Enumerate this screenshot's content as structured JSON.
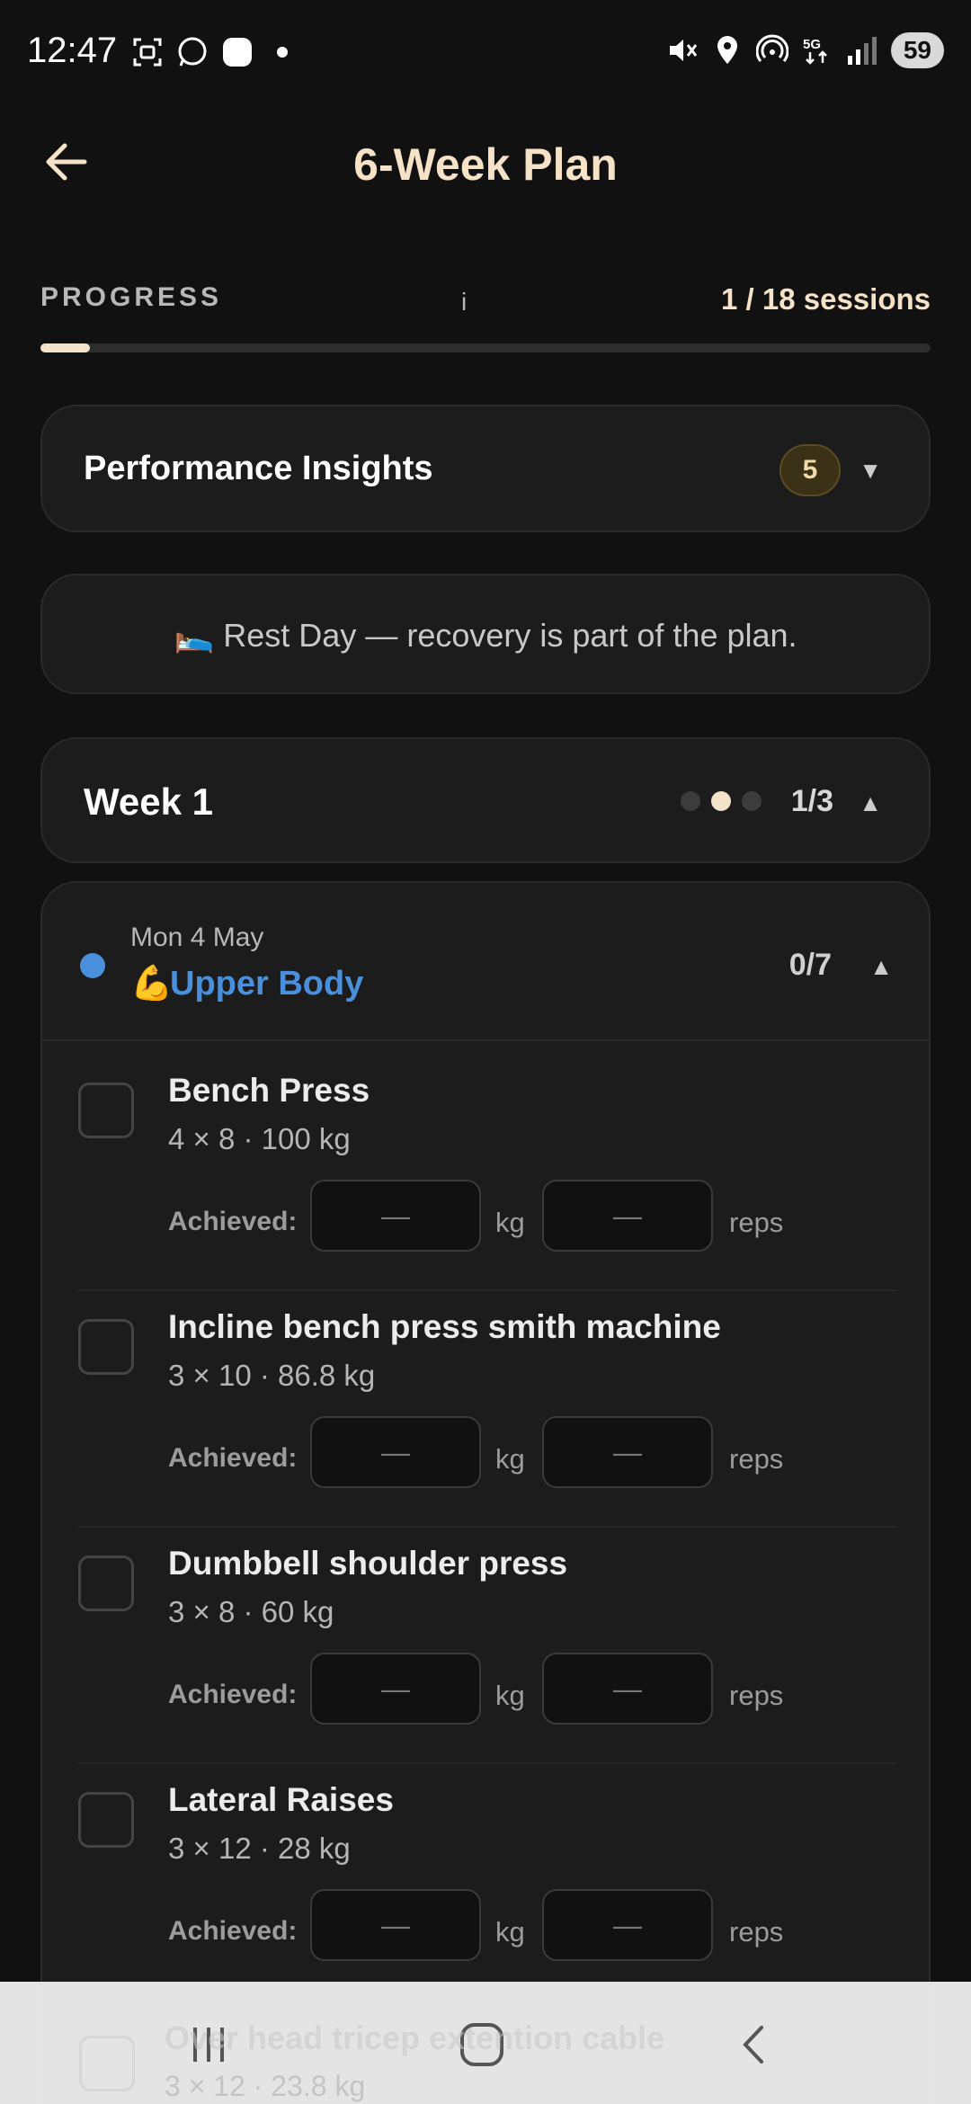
{
  "status_bar": {
    "time": "12:47",
    "left_icons": [
      "screenshot-icon",
      "whatsapp-icon",
      "wear-icon",
      "dot-icon"
    ],
    "right_icons": [
      "mute-icon",
      "location-icon",
      "hotspot-icon",
      "5g-icon",
      "signal-icon"
    ],
    "battery": "59"
  },
  "header": {
    "title": "6-Week Plan"
  },
  "progress": {
    "label": "PROGRESS",
    "info": "i",
    "sessions": "1 / 18 sessions",
    "fraction": 0.0556
  },
  "insights": {
    "title": "Performance Insights",
    "count": "5",
    "chevron": "▼"
  },
  "rest_day": {
    "emoji": "🛌",
    "text": "Rest Day — recovery is part of the plan."
  },
  "week": {
    "title": "Week 1",
    "count": "1/3",
    "chevron": "▲",
    "active_dot": 1
  },
  "day": {
    "date": "Mon 4 May",
    "emoji": "💪",
    "name": "Upper Body",
    "count": "0/7",
    "chevron": "▲"
  },
  "achieved_label": "Achieved:",
  "unit_kg": "kg",
  "unit_reps": "reps",
  "empty_value": "—",
  "exercises": [
    {
      "name": "Bench Press",
      "detail": "4 × 8  ·  100 kg"
    },
    {
      "name": "Incline bench press smith machine",
      "detail": "3 × 10  ·  86.8 kg"
    },
    {
      "name": "Dumbbell shoulder press",
      "detail": "3 × 8  ·  60 kg"
    },
    {
      "name": "Lateral Raises",
      "detail": "3 × 12  ·  28 kg"
    },
    {
      "name": "Over head tricep extention cable",
      "detail": "3 × 12  ·  23.8 kg"
    }
  ],
  "colors": {
    "accent": "#f3e3c8",
    "day_blue": "#4a8fdc",
    "background": "#111111",
    "card": "#1c1c1c"
  }
}
